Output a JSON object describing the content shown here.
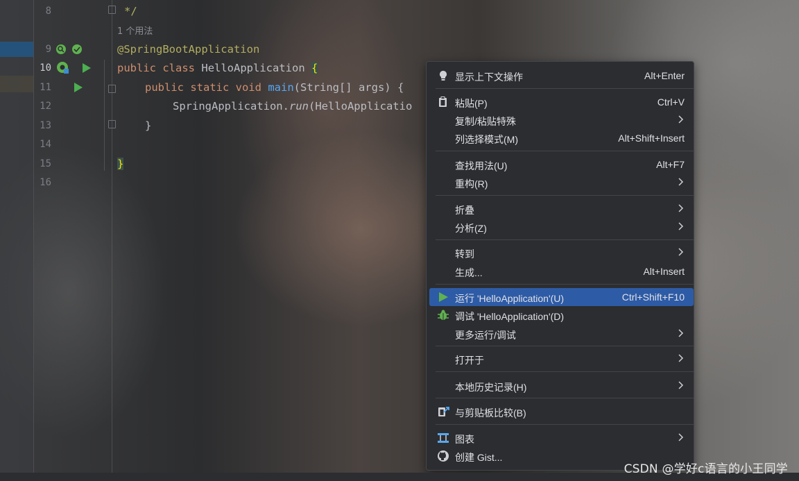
{
  "editor": {
    "line_numbers": [
      "8",
      "9",
      "10",
      "11",
      "12",
      "13",
      "14",
      "15",
      "16"
    ],
    "usage_hint": "1 个用法",
    "code": {
      "l8": "*/",
      "l9": "@SpringBootApplication",
      "l10_kw1": "public",
      "l10_kw2": "class",
      "l10_name": "HelloApplication",
      "l10_brace": "{",
      "l11_kw": "public static void",
      "l11_fn": "main",
      "l11_rest": "(String[] args) {",
      "l12_pre": "SpringApplication.",
      "l12_fn": "run",
      "l12_rest": "(HelloApplicatio",
      "l13": "}",
      "l15": "}"
    }
  },
  "context_menu": {
    "items": [
      {
        "label": "显示上下文操作",
        "shortcut": "Alt+Enter",
        "icon": "lightbulb-icon"
      },
      {
        "label": "粘贴(P)",
        "shortcut": "Ctrl+V",
        "icon": "clipboard-icon"
      },
      {
        "label": "复制/粘贴特殊",
        "submenu": true
      },
      {
        "label": "列选择模式(M)",
        "shortcut": "Alt+Shift+Insert"
      },
      {
        "label": "查找用法(U)",
        "shortcut": "Alt+F7"
      },
      {
        "label": "重构(R)",
        "submenu": true
      },
      {
        "label": "折叠",
        "submenu": true
      },
      {
        "label": "分析(Z)",
        "submenu": true
      },
      {
        "label": "转到",
        "submenu": true
      },
      {
        "label": "生成...",
        "shortcut": "Alt+Insert"
      },
      {
        "label": "运行 'HelloApplication'(U)",
        "shortcut": "Ctrl+Shift+F10",
        "icon": "run-icon",
        "selected": true
      },
      {
        "label": "调试 'HelloApplication'(D)",
        "icon": "debug-bug-icon"
      },
      {
        "label": "更多运行/调试",
        "submenu": true
      },
      {
        "label": "打开于",
        "submenu": true
      },
      {
        "label": "本地历史记录(H)",
        "submenu": true
      },
      {
        "label": "与剪贴板比较(B)",
        "icon": "compare-clipboard-icon"
      },
      {
        "label": "图表",
        "submenu": true,
        "icon": "diagram-icon"
      },
      {
        "label": "创建 Gist...",
        "icon": "github-icon"
      }
    ],
    "selected_color": "#2e5ba6"
  },
  "watermark": "CSDN @学好c语言的小王同学",
  "colors": {
    "keyword": "#cf8e6d",
    "annotation": "#b3ae60",
    "function": "#56a8f5",
    "run_green": "#4caf50"
  }
}
